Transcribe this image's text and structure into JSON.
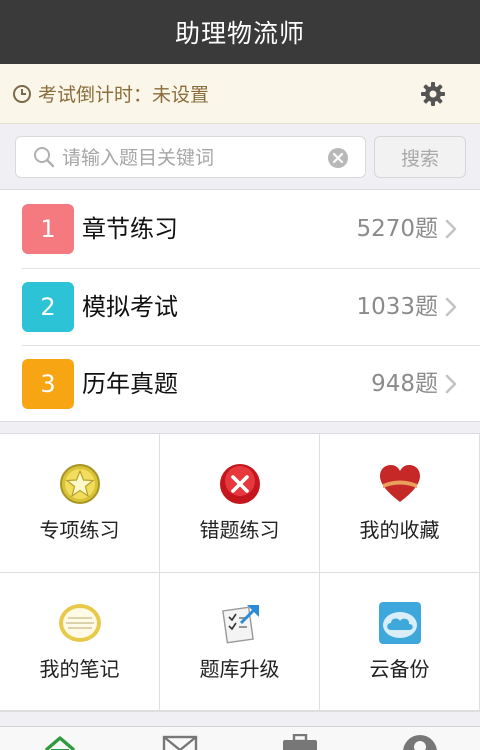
{
  "header": {
    "title": "助理物流师"
  },
  "countdown": {
    "text": "考试倒计时：未设置"
  },
  "search": {
    "placeholder": "请输入题目关键词",
    "button_label": "搜索"
  },
  "sections": [
    {
      "number": "1",
      "label": "章节练习",
      "count": "5270题",
      "color": "#f47a80"
    },
    {
      "number": "2",
      "label": "模拟考试",
      "count": "1033题",
      "color": "#2bc3d5"
    },
    {
      "number": "3",
      "label": "历年真题",
      "count": "948题",
      "color": "#f8a514"
    }
  ],
  "features": [
    {
      "label": "专项练习",
      "icon": "star-badge-icon"
    },
    {
      "label": "错题练习",
      "icon": "red-x-icon"
    },
    {
      "label": "我的收藏",
      "icon": "heart-icon"
    },
    {
      "label": "我的笔记",
      "icon": "notepad-icon"
    },
    {
      "label": "题库升级",
      "icon": "checklist-icon"
    },
    {
      "label": "云备份",
      "icon": "cloud-icon"
    }
  ],
  "tabs": [
    {
      "icon": "home-icon",
      "color": "#2e9b3e"
    },
    {
      "icon": "mail-icon",
      "color": "#777777"
    },
    {
      "icon": "briefcase-icon",
      "color": "#777777"
    },
    {
      "icon": "user-icon",
      "color": "#777777"
    }
  ]
}
